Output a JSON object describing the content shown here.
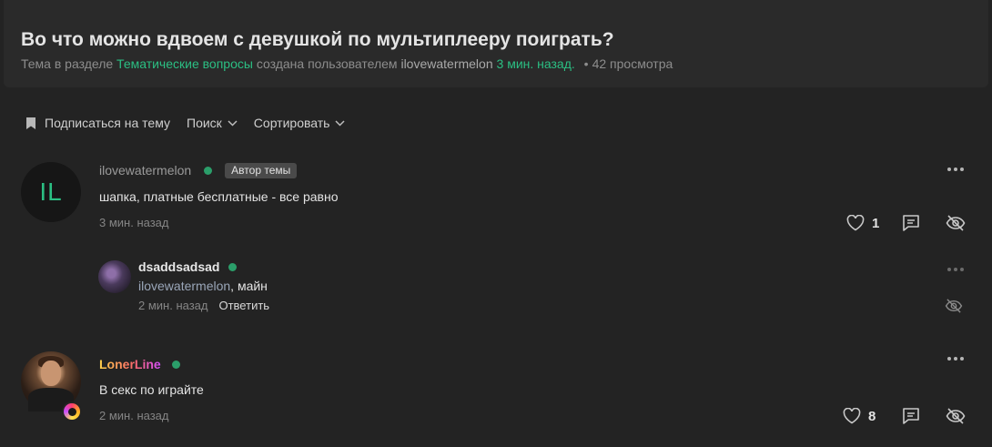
{
  "thread": {
    "title": "Во что можно вдвоем с девушкой по мультиплееру поиграть?",
    "meta_prefix": "Тема в разделе",
    "section": "Тематические вопросы",
    "meta_mid": "создана пользователем",
    "author": "ilovewatermelon",
    "created": "3 мин. назад.",
    "views": "42 просмотра"
  },
  "toolbar": {
    "subscribe": "Подписаться на тему",
    "search": "Поиск",
    "sort": "Сортировать"
  },
  "posts": [
    {
      "avatar_initials": "IL",
      "username": "ilovewatermelon",
      "author_tag": "Автор темы",
      "text": "шапка, платные бесплатные - все равно",
      "time": "3 мин. назад",
      "likes": "1",
      "reply": {
        "username": "dsaddsadsad",
        "mention": "ilovewatermelon",
        "text": ", майн",
        "time": "2 мин. назад",
        "reply_label": "Ответить"
      }
    },
    {
      "username": "LonerLine",
      "text": "В секс по играйте",
      "time": "2 мин. назад",
      "likes": "8"
    }
  ],
  "icons": {
    "bookmark": "bookmark-icon",
    "chevron": "chevron-down-icon",
    "like": "heart-icon",
    "comment": "comment-icon",
    "hide": "eye-off-icon",
    "more": "more-horizontal-icon"
  },
  "colors": {
    "accent": "#2bbf83",
    "online": "#2b9e6a"
  }
}
